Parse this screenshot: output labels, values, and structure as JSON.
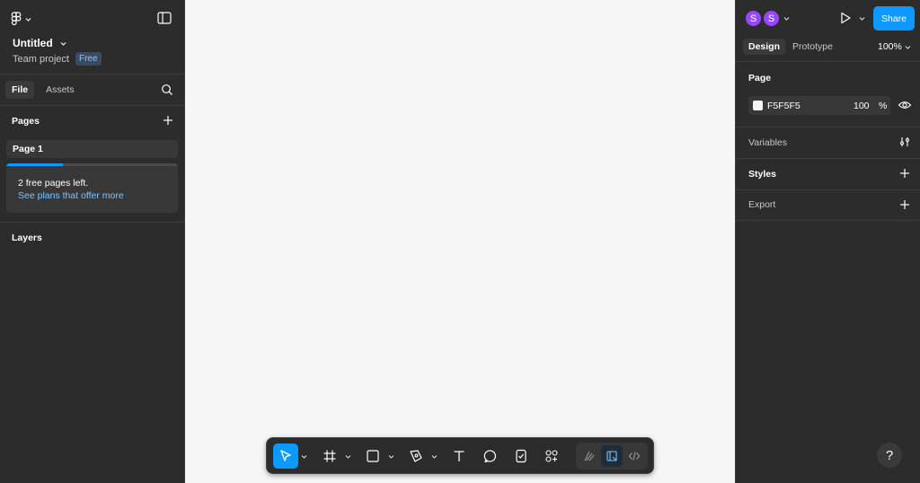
{
  "left_panel": {
    "file": {
      "title": "Untitled",
      "project": "Team project",
      "plan_badge": "Free"
    },
    "tabs": [
      {
        "label": "File",
        "active": true
      },
      {
        "label": "Assets",
        "active": false
      }
    ],
    "pages": {
      "title": "Pages",
      "items": [
        {
          "label": "Page 1"
        }
      ]
    },
    "upgrade": {
      "message": "2 free pages left.",
      "link": "See plans that offer more",
      "progress": 0.33
    },
    "layers": {
      "title": "Layers"
    }
  },
  "canvas": {
    "background": "#f5f5f5"
  },
  "toolbar": {
    "tools": [
      "move-tool",
      "frame-tool",
      "rectangle-tool",
      "pen-tool",
      "text-tool",
      "comment-tool",
      "actions-tool",
      "components-tool"
    ],
    "modes": [
      "draw-mode",
      "design-mode",
      "dev-mode"
    ],
    "accent": "#0d99ff"
  },
  "right_panel": {
    "avatars": [
      "S",
      "S"
    ],
    "share_label": "Share",
    "tabs": [
      {
        "label": "Design",
        "active": true
      },
      {
        "label": "Prototype",
        "active": false
      }
    ],
    "zoom": "100%",
    "page": {
      "title": "Page",
      "fill_hex": "F5F5F5",
      "opacity": "100",
      "opacity_unit": "%"
    },
    "variables_label": "Variables",
    "styles_label": "Styles",
    "export_label": "Export",
    "help_label": "?"
  }
}
